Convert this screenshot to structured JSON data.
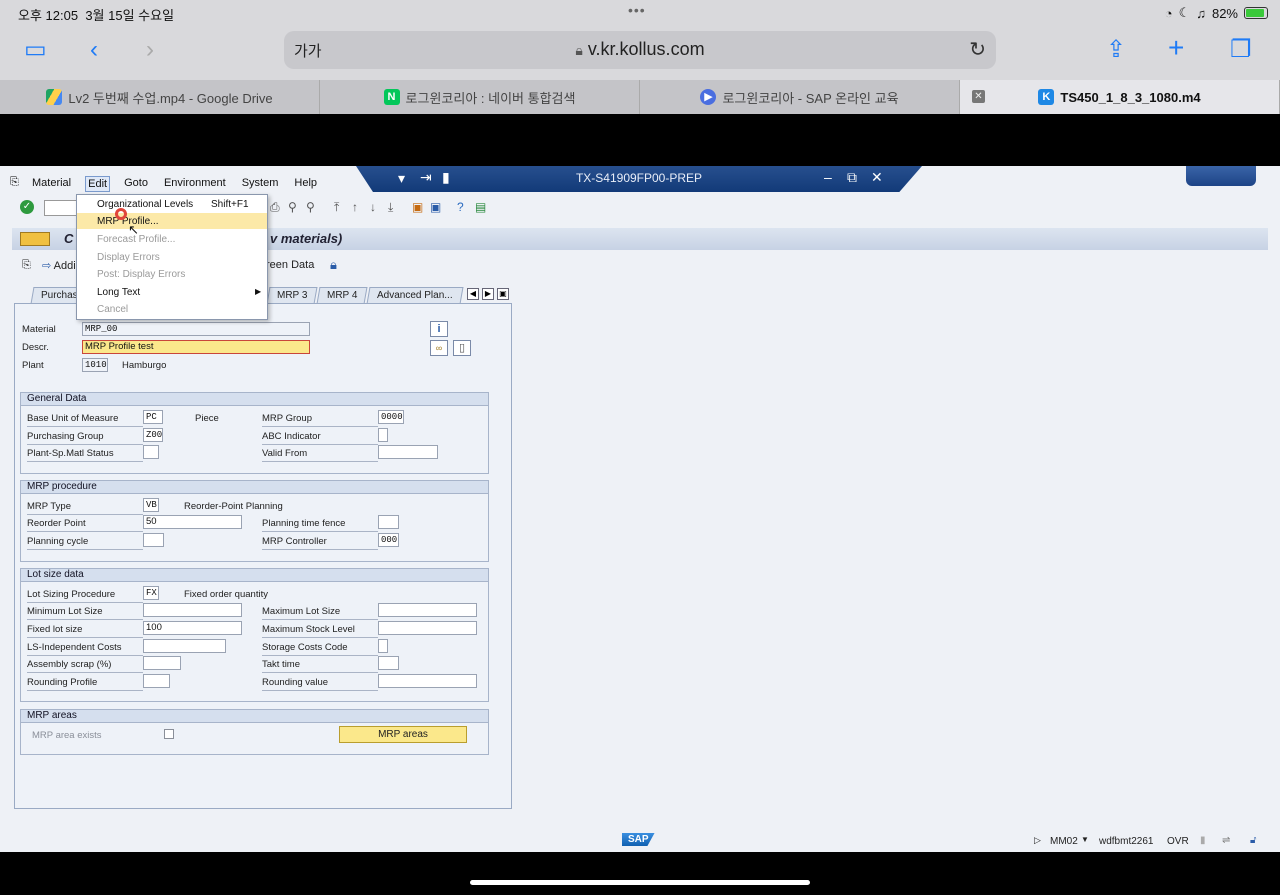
{
  "ios": {
    "time": "오후 12:05",
    "date": "3월 15일 수요일",
    "battery": "82%"
  },
  "safari": {
    "text_size": "가가",
    "url": "v.kr.kollus.com"
  },
  "tabs": [
    {
      "label": "Lv2 두번째 수업.mp4 - Google Drive",
      "icon": "google-drive-icon"
    },
    {
      "label": "로그윈코리아 : 네이버 통합검색",
      "icon": "naver-icon"
    },
    {
      "label": "로그윈코리아 - SAP 온라인 교육",
      "icon": "play-icon"
    },
    {
      "label": "TS450_1_8_3_1080.m4",
      "icon": "kollus-icon",
      "active": true
    }
  ],
  "sap": {
    "window_title": "TX-S41909FP00-PREP",
    "menus": [
      "Material",
      "Edit",
      "Goto",
      "Environment",
      "System",
      "Help"
    ],
    "page_title_left": "C",
    "page_title_right": "v materials)",
    "app_toolbar": {
      "additional": "Addi",
      "screen_data": "reen Data"
    },
    "edit_menu": [
      {
        "label": "Organizational Levels",
        "shortcut": "Shift+F1",
        "enabled": true
      },
      {
        "label": "MRP Profile...",
        "enabled": true,
        "highlight": true
      },
      {
        "label": "Forecast Profile...",
        "enabled": false
      },
      {
        "label": "Display Errors",
        "enabled": false
      },
      {
        "label": "Post: Display Errors",
        "enabled": false
      },
      {
        "label": "Long Text",
        "enabled": true,
        "submenu": true
      },
      {
        "label": "Cancel",
        "enabled": false
      }
    ],
    "tabs": [
      "Purchas",
      "MRP 3",
      "MRP 4",
      "Advanced Plan..."
    ],
    "header": {
      "material_label": "Material",
      "material": "MRP_00",
      "descr_label": "Descr.",
      "descr": "MRP Profile test",
      "plant_label": "Plant",
      "plant": "1010",
      "plant_name": "Hamburgo"
    },
    "general": {
      "title": "General Data",
      "buom_label": "Base Unit of Measure",
      "buom": "PC",
      "buom_text": "Piece",
      "mrp_group_label": "MRP Group",
      "mrp_group": "0000",
      "pgroup_label": "Purchasing Group",
      "pgroup": "Z00",
      "abc_label": "ABC Indicator",
      "psm_label": "Plant-Sp.Matl Status",
      "valid_label": "Valid From"
    },
    "procedure": {
      "title": "MRP procedure",
      "type_label": "MRP Type",
      "type": "VB",
      "type_text": "Reorder-Point Planning",
      "reorder_label": "Reorder Point",
      "reorder": "50",
      "ptf_label": "Planning time fence",
      "cycle_label": "Planning cycle",
      "controller_label": "MRP Controller",
      "controller": "000"
    },
    "lotsize": {
      "title": "Lot size data",
      "proc_label": "Lot Sizing Procedure",
      "proc": "FX",
      "proc_text": "Fixed order quantity",
      "min_label": "Minimum Lot Size",
      "max_label": "Maximum Lot Size",
      "fixed_label": "Fixed lot size",
      "fixed": "100",
      "maxstock_label": "Maximum Stock Level",
      "lsind_label": "LS-Independent Costs",
      "storage_label": "Storage Costs Code",
      "scrap_label": "Assembly scrap (%)",
      "takt_label": "Takt time",
      "rprof_label": "Rounding Profile",
      "rval_label": "Rounding value"
    },
    "areas": {
      "title": "MRP areas",
      "exists_label": "MRP area exists",
      "button": "MRP areas"
    },
    "status": {
      "sap_logo": "SAP",
      "tcode": "MM02",
      "user": "wdfbmt2261",
      "mode": "OVR"
    }
  }
}
